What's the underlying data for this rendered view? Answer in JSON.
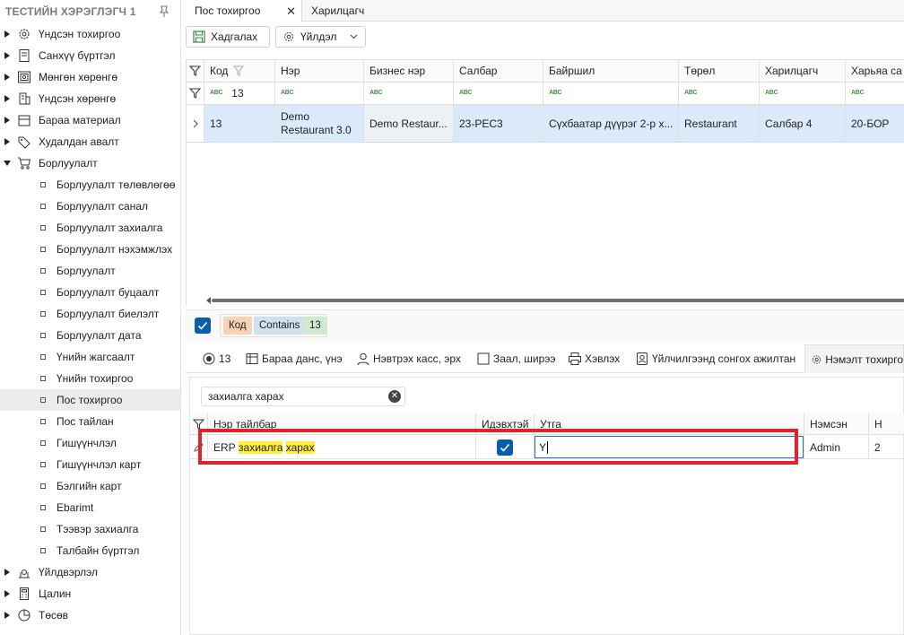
{
  "sidebar": {
    "title": "ТЕСТИЙН ХЭРЭГЛЭГЧ 1",
    "items": [
      {
        "label": "Үндсэн тохиргоо",
        "icon": "gear-icon",
        "expanded": false
      },
      {
        "label": "Санхүү бүртгэл",
        "icon": "ledger-icon",
        "expanded": false
      },
      {
        "label": "Мөнгөн хөрөнгө",
        "icon": "cash-icon",
        "expanded": false
      },
      {
        "label": "Үндсэн хөрөнгө",
        "icon": "building-icon",
        "expanded": false
      },
      {
        "label": "Бараа материал",
        "icon": "box-icon",
        "expanded": false
      },
      {
        "label": "Худалдан авалт",
        "icon": "tag-icon",
        "expanded": false
      },
      {
        "label": "Борлуулалт",
        "icon": "cart-icon",
        "expanded": true
      }
    ],
    "sub_items": [
      "Борлуулалт төлөвлөгөө",
      "Борлуулалт санал",
      "Борлуулалт захиалга",
      "Борлуулалт нэхэмжлэх",
      "Борлуулалт",
      "Борлуулалт буцаалт",
      "Борлуулалт биелэлт",
      "Борлуулалт дата",
      "Үнийн жагсаалт",
      "Үнийн тохиргоо",
      "Пос тохиргоо",
      "Пос тайлан",
      "Гишүүнчлэл",
      "Гишүүнчлэл карт",
      "Бэлгийн карт",
      "Ebarimt",
      "Тээвэр захиалга",
      "Талбайн бүртгэл"
    ],
    "active_sub_item": "Пос тохиргоо",
    "bottom_items": [
      {
        "label": "Үйлдвэрлэл",
        "icon": "factory-icon"
      },
      {
        "label": "Цалин",
        "icon": "calculator-icon"
      },
      {
        "label": "Төсөв",
        "icon": "pie-chart-icon"
      }
    ]
  },
  "tabs": {
    "active": "Пос тохиргоо",
    "other": "Харилцагч",
    "close": "✕"
  },
  "toolbar": {
    "save_label": "Хадгалах",
    "action_label": "Үйлдэл"
  },
  "grid": {
    "columns": [
      "Код",
      "Нэр",
      "Бизнес нэр",
      "Салбар",
      "Байршил",
      "Төрөл",
      "Харилцагч",
      "Харьяа са"
    ],
    "filter_code": "13",
    "abc": "ABC",
    "row": {
      "code": "13",
      "name_line1": "Demo",
      "name_line2": "Restaurant 3.0",
      "business_name": "Demo Restaur...",
      "branch": "23-РЕС3",
      "location": "Сүхбаатар дүүрэг 2-р х...",
      "type": "Restaurant",
      "customer": "Салбар 4",
      "affiliation": "20-БОР"
    }
  },
  "filter_summary": {
    "field": "Код",
    "operator": "Contains",
    "value": "13"
  },
  "detail_tabs": [
    {
      "label": "13",
      "icon": "radio-icon"
    },
    {
      "label": "Бараа данс, үнэ",
      "icon": "table-icon"
    },
    {
      "label": "Нэвтрэх касс, эрх",
      "icon": "user-icon"
    },
    {
      "label": "Заал, ширээ",
      "icon": "square-icon"
    },
    {
      "label": "Хэвлэх",
      "icon": "printer-icon"
    },
    {
      "label": "Үйлчилгээнд сонгох ажилтан",
      "icon": "badge-icon"
    },
    {
      "label": "Нэмэлт тохирго",
      "icon": "gear-icon"
    }
  ],
  "settings": {
    "search_value": "захиалга харах",
    "clear": "✕",
    "columns": [
      "Нэр тайлбар",
      "Идэвхтэй",
      "Утга",
      "Нэмсэн",
      "Н"
    ],
    "row": {
      "name_prefix": "ERP",
      "name_hl1": "захиалга",
      "name_hl2": "харах",
      "active": true,
      "value": "Y",
      "added_by": "Admin",
      "extra": "2"
    }
  }
}
